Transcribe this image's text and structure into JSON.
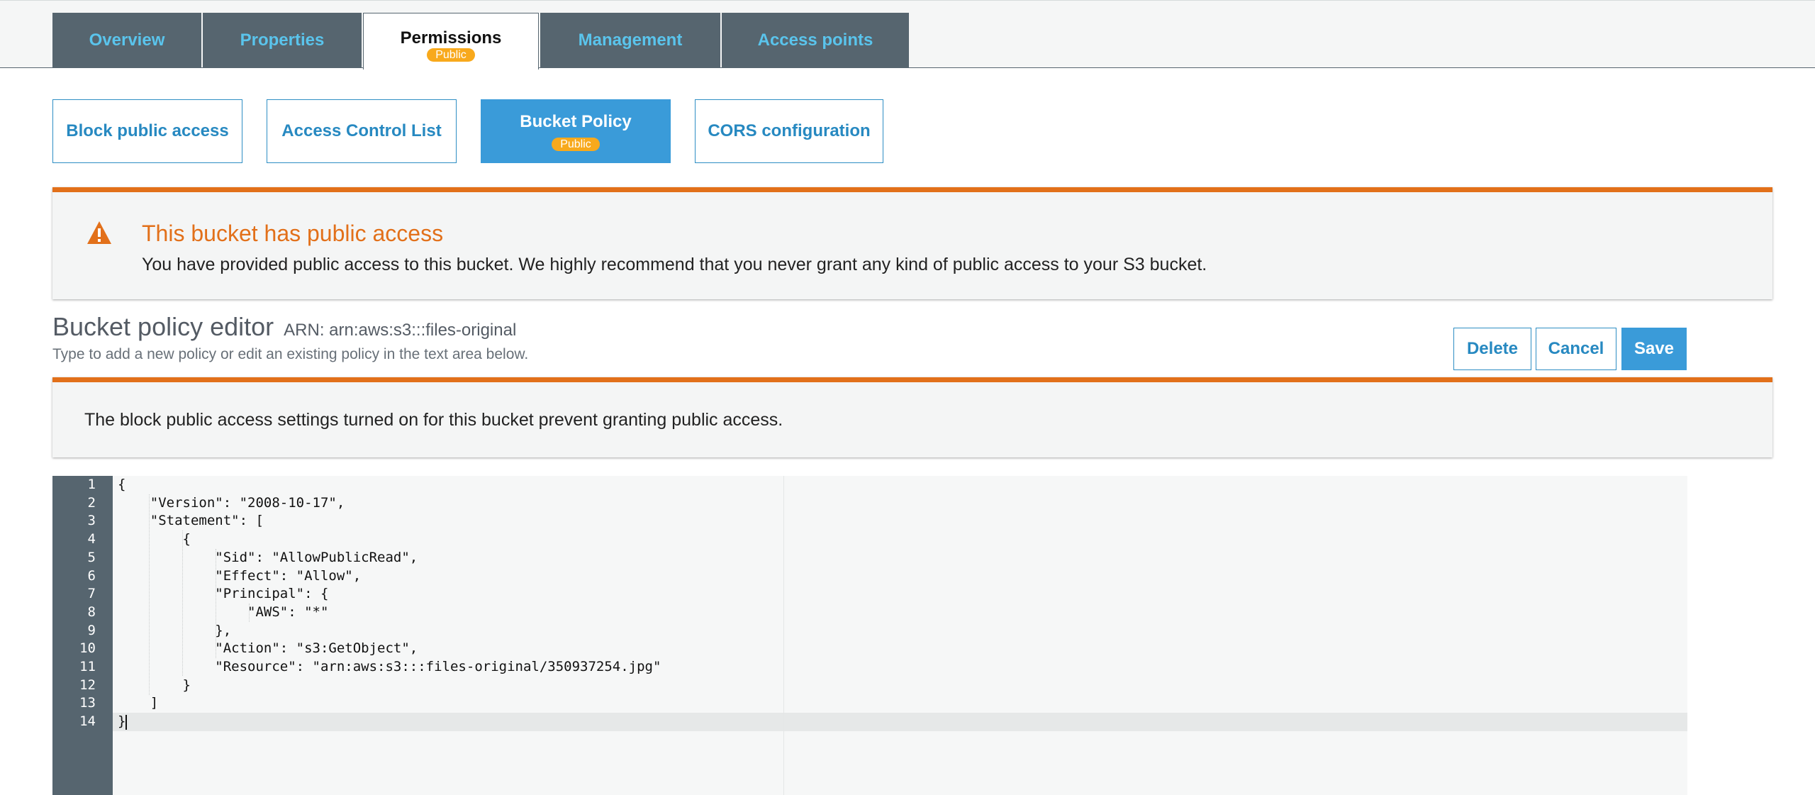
{
  "top_tabs": [
    {
      "label": "Overview"
    },
    {
      "label": "Properties"
    },
    {
      "label": "Permissions",
      "badge": "Public",
      "active": true
    },
    {
      "label": "Management"
    },
    {
      "label": "Access points"
    }
  ],
  "sub_tabs": [
    {
      "label": "Block public access"
    },
    {
      "label": "Access Control List"
    },
    {
      "label": "Bucket Policy",
      "badge": "Public",
      "active": true
    },
    {
      "label": "CORS configuration"
    }
  ],
  "public_alert": {
    "title": "This bucket has public access",
    "message": "You have provided public access to this bucket. We highly recommend that you never grant any kind of public access to your S3 bucket."
  },
  "editor": {
    "title": "Bucket policy editor",
    "arn": "ARN: arn:aws:s3:::files-original",
    "description": "Type to add a new policy or edit an existing policy in the text area below.",
    "buttons": {
      "delete": "Delete",
      "cancel": "Cancel",
      "save": "Save"
    }
  },
  "block_alert": {
    "message": "The block public access settings turned on for this bucket prevent granting public access."
  },
  "code": {
    "line_numbers": [
      "1",
      "2",
      "3",
      "4",
      "5",
      "6",
      "7",
      "8",
      "9",
      "10",
      "11",
      "12",
      "13",
      "14"
    ],
    "lines": [
      "{",
      "    \"Version\": \"2008-10-17\",",
      "    \"Statement\": [",
      "        {",
      "            \"Sid\": \"AllowPublicRead\",",
      "            \"Effect\": \"Allow\",",
      "            \"Principal\": {",
      "                \"AWS\": \"*\"",
      "            },",
      "            \"Action\": \"s3:GetObject\",",
      "            \"Resource\": \"arn:aws:s3:::files-original/350937254.jpg\"",
      "        }",
      "    ]",
      "}"
    ]
  },
  "colors": {
    "accent_blue": "#3a9bd9",
    "warning_orange": "#e2701a",
    "badge_orange": "#f8a91c",
    "tab_gray": "#56656f"
  },
  "icons": {
    "warning": "warning-triangle-icon"
  }
}
